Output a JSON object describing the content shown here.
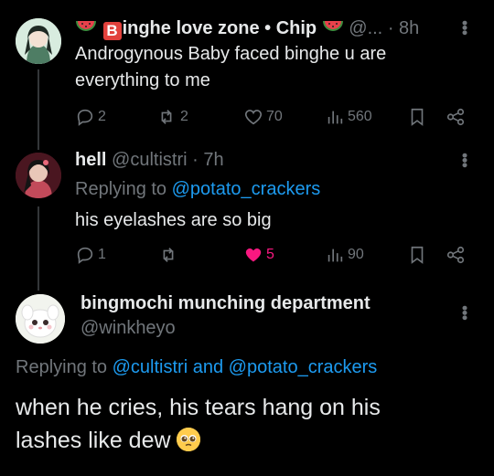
{
  "tweets": [
    {
      "name_prefix": "B",
      "name_rest": "inghe love zone • Chip",
      "handle": "@...",
      "time": "· 8h",
      "text": "Androgynous Baby faced binghe u are everything to me",
      "replies": "2",
      "retweets": "2",
      "likes": "70",
      "views": "560"
    },
    {
      "name": "hell",
      "handle": "@cultistri",
      "time": "· 7h",
      "replying_label": "Replying to",
      "replying_to": "@potato_crackers",
      "text": "his eyelashes are so big",
      "replies": "1",
      "retweets": "",
      "likes": "5",
      "views": "90"
    },
    {
      "name": "bingmochi munching department",
      "handle": "@winkheyo",
      "replying_label": "Replying to",
      "replying_to_1": "@cultistri",
      "replying_and": "and",
      "replying_to_2": "@potato_crackers",
      "text_line1": "when he cries, his tears hang on his",
      "text_line2": "lashes like dew"
    }
  ],
  "colors": {
    "background": "#000000",
    "text": "#e7e9ea",
    "muted": "#71767b",
    "link": "#1d9bf0",
    "like": "#f91880"
  }
}
